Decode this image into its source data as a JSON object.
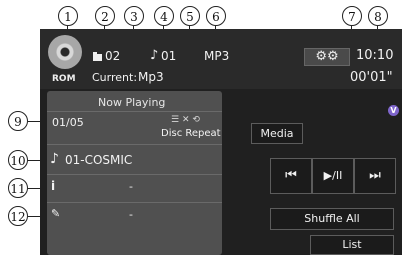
{
  "callouts": [
    "1",
    "2",
    "3",
    "4",
    "5",
    "6",
    "7",
    "8",
    "9",
    "10",
    "11",
    "12"
  ],
  "header": {
    "rom_label": "ROM",
    "folder_number": "02",
    "track_number": "01",
    "format": "MP3",
    "current_label": "Current:",
    "current_value": "Mp3",
    "clock": "10:10",
    "elapsed": "00'01\""
  },
  "panel": {
    "title": "Now Playing",
    "track_count": "01/05",
    "repeat_mode": "Disc Repeat",
    "track_title": "01-COSMIC",
    "artist": "-",
    "album": "-"
  },
  "controls": {
    "media_label": "Media",
    "prev_label": "⏮",
    "play_pause_label": "▶/II",
    "next_label": "⏭",
    "shuffle_label": "Shuffle All",
    "list_label": "List"
  },
  "icons": {
    "settings": "gear-icon",
    "music_note": "music-note-icon",
    "artist": "person-icon",
    "album": "pen-icon"
  }
}
